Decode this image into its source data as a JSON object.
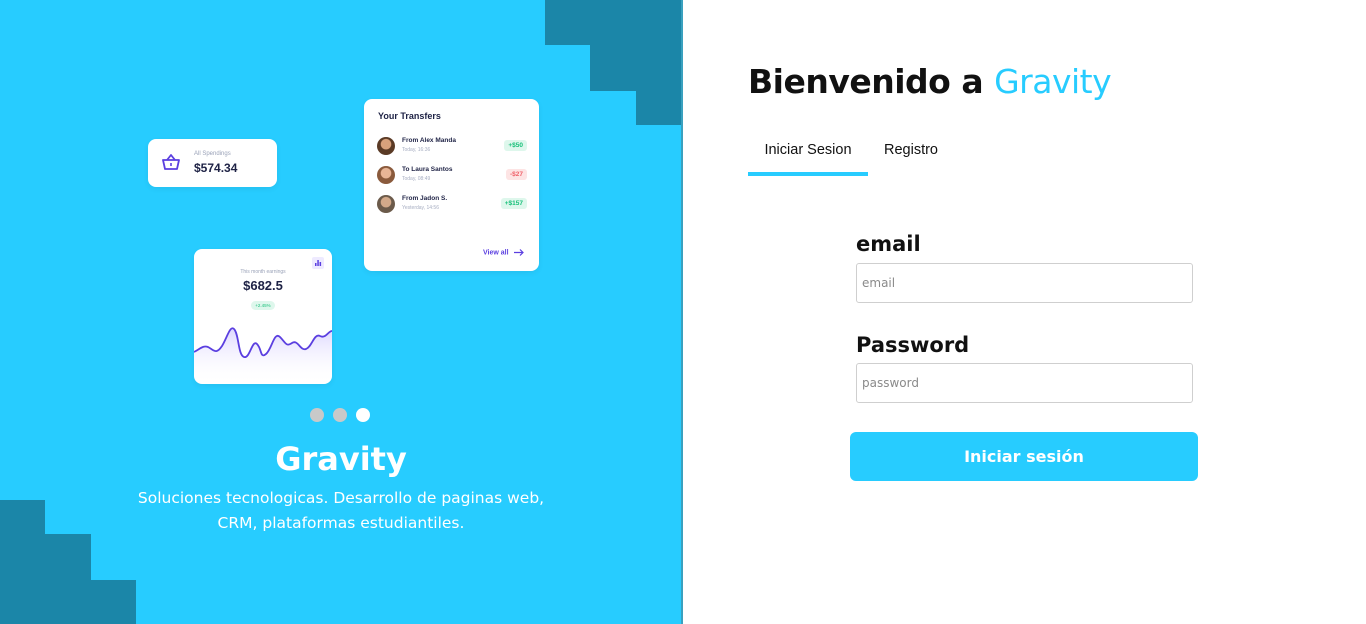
{
  "colors": {
    "brand_blue": "#27ccff",
    "dark_step_blue": "#1b86a8",
    "text_dark": "#111111",
    "positive_green": "#19c07a",
    "negative_red": "#f0616a",
    "link_purple": "#5b3fe0"
  },
  "showcase": {
    "spendings": {
      "icon": "basket-icon",
      "label": "All Spendings",
      "value": "$574.34"
    },
    "transfers": {
      "title": "Your Transfers",
      "items": [
        {
          "name": "From Alex Manda",
          "date": "Today, 16:36",
          "amount": "+$50",
          "type": "positive"
        },
        {
          "name": "To Laura Santos",
          "date": "Today, 08:49",
          "amount": "-$27",
          "type": "negative"
        },
        {
          "name": "From Jadon S.",
          "date": "Yesterday, 14:56",
          "amount": "+$157",
          "type": "positive"
        }
      ],
      "view_all": "View all"
    },
    "earnings": {
      "icon": "bar-chart-icon",
      "label": "This month earnings",
      "value": "$682.5",
      "change": "+2.45%"
    },
    "carousel": {
      "slides": 3,
      "active_index": 2
    }
  },
  "brand": {
    "name": "Gravity",
    "description_line1": "Soluciones tecnologicas. Desarrollo de paginas web,",
    "description_line2": "CRM, plataformas estudiantiles."
  },
  "login": {
    "welcome_prefix": "Bienvenido a",
    "welcome_brand": "Gravity",
    "tabs": [
      {
        "label": "Iniciar Sesion",
        "active": true
      },
      {
        "label": "Registro",
        "active": false
      }
    ],
    "email_label": "email",
    "email_placeholder": "email",
    "email_value": "",
    "password_label": "Password",
    "password_placeholder": "password",
    "password_value": "",
    "submit_label": "Iniciar sesión"
  }
}
